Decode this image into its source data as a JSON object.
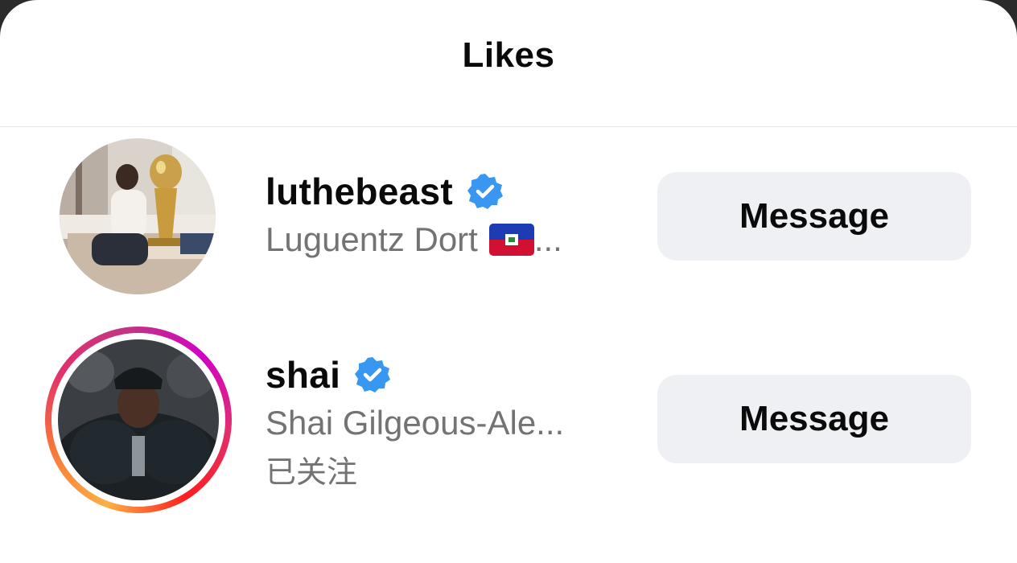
{
  "sheet": {
    "title": "Likes"
  },
  "users": [
    {
      "username": "luthebeast",
      "verified": true,
      "full_name": "Luguentz Dort",
      "full_name_suffix": "...",
      "has_story_ring": false,
      "follow_status": "",
      "action_label": "Message"
    },
    {
      "username": "shai",
      "verified": true,
      "full_name": "Shai Gilgeous-Ale...",
      "has_story_ring": true,
      "follow_status": "已关注",
      "action_label": "Message"
    }
  ],
  "colors": {
    "verified_blue": "#3897f0",
    "secondary_text": "#737373",
    "button_bg": "#eff0f3"
  }
}
